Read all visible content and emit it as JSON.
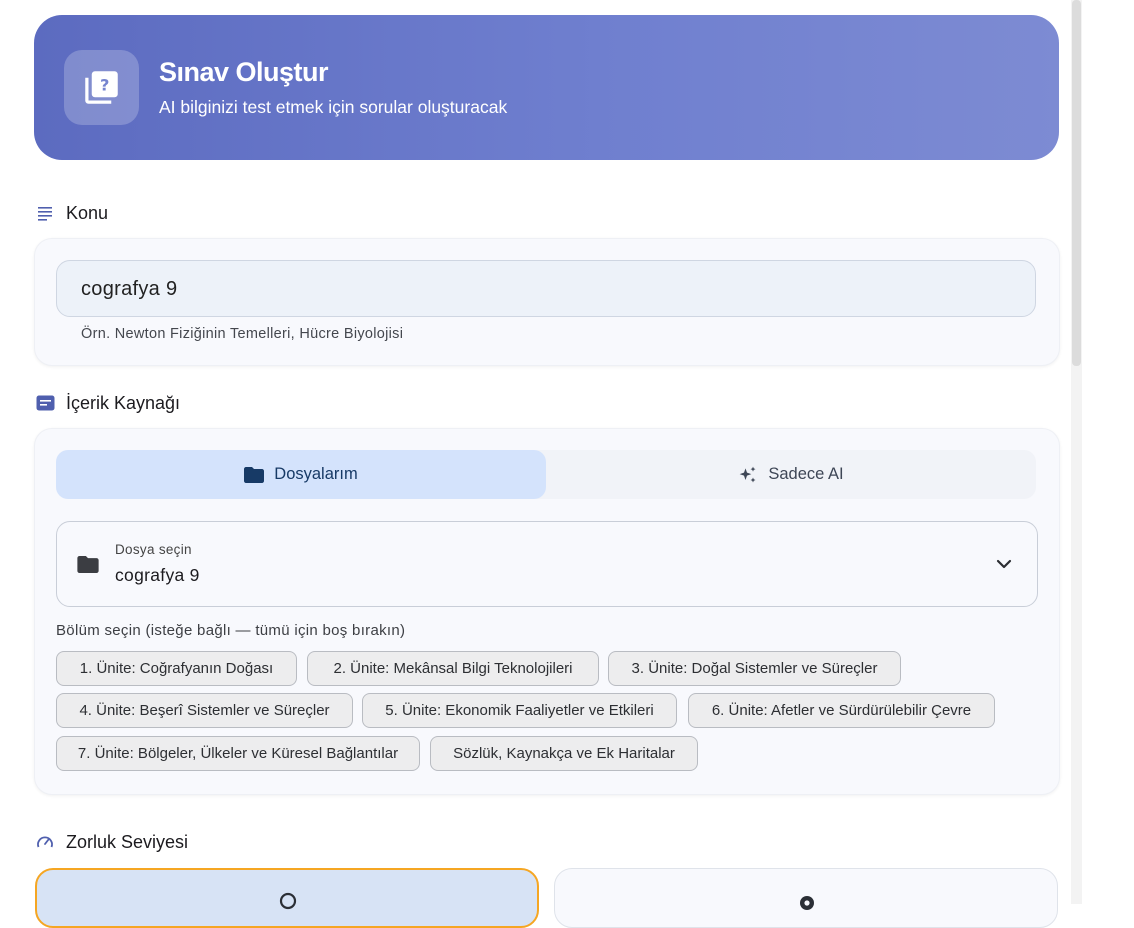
{
  "header": {
    "title": "Sınav Oluştur",
    "subtitle": "AI bilginizi test etmek için sorular oluşturacak",
    "icon": "quiz-icon"
  },
  "topic_section": {
    "title": "Konu",
    "icon": "notes-icon",
    "input_value": "cografya 9",
    "hint": "Örn. Newton Fiziğinin Temelleri, Hücre Biyolojisi"
  },
  "source_section": {
    "title": "İçerik Kaynağı",
    "icon": "source-icon",
    "tabs": [
      {
        "label": "Dosyalarım",
        "icon": "folder-icon",
        "active": true
      },
      {
        "label": "Sadece AI",
        "icon": "sparkle-icon",
        "active": false
      }
    ],
    "file_select": {
      "label": "Dosya seçin",
      "value": "cografya 9",
      "icon": "folder-icon"
    },
    "chapters_label": "Bölüm seçin (isteğe bağlı — tümü için boş bırakın)",
    "chapters": [
      "1. Ünite: Coğrafyanın Doğası",
      "2. Ünite: Mekânsal Bilgi Teknolojileri",
      "3. Ünite: Doğal Sistemler ve Süreçler",
      "4. Ünite: Beşerî Sistemler ve Süreçler",
      "5. Ünite: Ekonomik Faaliyetler ve Etkileri",
      "6. Ünite: Afetler ve Sürdürülebilir Çevre",
      "7. Ünite: Bölgeler, Ülkeler ve Küresel Bağlantılar",
      "Sözlük, Kaynakça ve Ek Haritalar"
    ]
  },
  "difficulty_section": {
    "title": "Zorluk Seviyesi",
    "icon": "speed-icon"
  },
  "colors": {
    "header_gradient_start": "#5c6bc0",
    "header_gradient_end": "#7d8bd3",
    "active_tab_bg": "#d4e3fc",
    "selected_outline": "#f5a623",
    "section_icon": "#4f5fae"
  }
}
